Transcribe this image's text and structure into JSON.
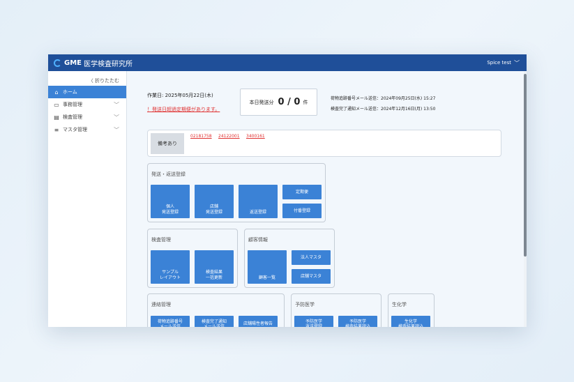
{
  "header": {
    "logo_gme": "GME",
    "app_title": "医学検査研究所",
    "user_name": "Spice test"
  },
  "sidebar": {
    "collapse_label": "〈 折りたたむ",
    "items": [
      {
        "label": "ホーム",
        "icon": "home-icon",
        "active": true
      },
      {
        "label": "事務管理",
        "icon": "office-icon"
      },
      {
        "label": "検査管理",
        "icon": "document-icon"
      },
      {
        "label": "マスタ管理",
        "icon": "database-icon"
      }
    ]
  },
  "main": {
    "work_date": "作業日: 2025年05月22日(木)",
    "warning": "！発送日超過定期便があります。",
    "ship_label": "本日発送分",
    "ship_count": "0 / 0",
    "ship_unit": "件",
    "mail_tracking": "荷物追跡番号メール送信：2024年09月25日(水) 15:27",
    "mail_complete": "検査完了通知メール送信：2024年12月16日(月) 13:50",
    "notes_badge": "備考あり",
    "notes_links": [
      "02181758",
      "24122001",
      "3400161"
    ]
  },
  "panels": {
    "shipping": {
      "title": "発送・返送登録",
      "personal": "個人\n発送登録",
      "store": "店舗\n発送登録",
      "return": "返送登録",
      "regular": "定期便",
      "numbering": "付番登録"
    },
    "inspection": {
      "title": "検査管理",
      "sample_layout": "サンプル\nレイアウト",
      "bulk_update": "検査結果\n一括更新"
    },
    "customer": {
      "title": "顧客情報",
      "customer_list": "顧客一覧",
      "corporate_master": "法人マスタ",
      "store_master": "店舗マスタ"
    },
    "contact": {
      "title": "連絡管理",
      "tracking_mail": "荷物追跡番号\nメール送信",
      "complete_mail": "検査完了通知\nメール送信",
      "store_abnormal": "店舗陽性者報告"
    },
    "preventive": {
      "title": "予防医学",
      "return_register": "予防医学\n返送登録",
      "result_import": "予防医学\n検査結果読込"
    },
    "biochem": {
      "title": "生化学",
      "result_import": "生化学\n検査結果読込"
    }
  },
  "colors": {
    "topbar": "#1f4f99",
    "accent": "#3b82d6",
    "warning": "#e03030"
  }
}
